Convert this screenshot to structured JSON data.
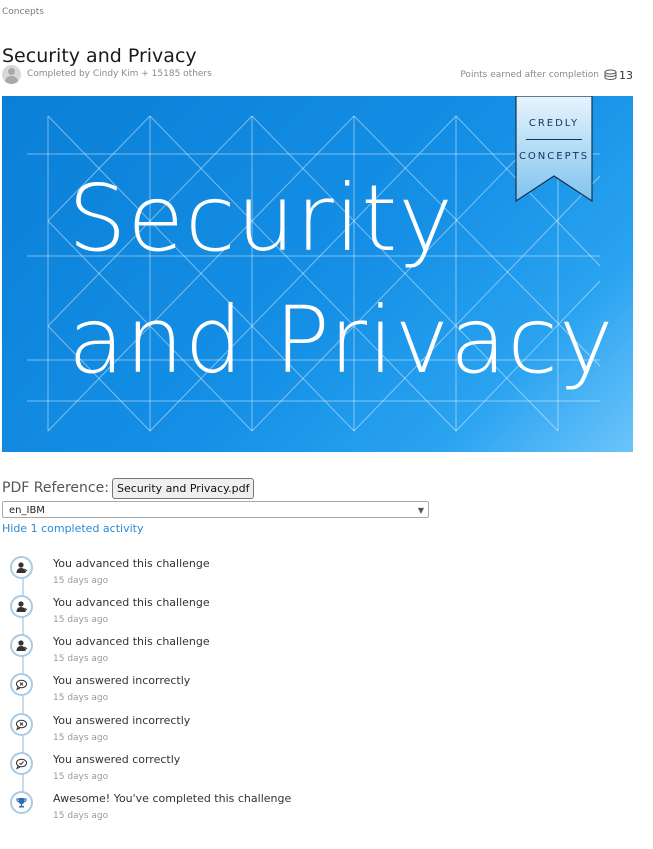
{
  "breadcrumb": "Concepts",
  "title": "Security and Privacy",
  "meta": {
    "completed_text": "Completed by Cindy Kim + 15185 others",
    "points_label": "Points earned after completion",
    "points_value": "13"
  },
  "banner": {
    "title_line1": "Security",
    "title_line2": "and Privacy",
    "ribbon_line1": "CREDLY",
    "ribbon_line2": "CONCEPTS",
    "gradient": [
      "#0a7fd6",
      "#6cc4fa"
    ]
  },
  "pdf": {
    "label": "PDF Reference:",
    "button_label": "Security and Privacy.pdf"
  },
  "language_select": {
    "selected": "en_IBM"
  },
  "hide_link": "Hide 1 completed activity",
  "activities": [
    {
      "icon": "user-advance-icon",
      "title": "You advanced this challenge",
      "time": "15 days ago"
    },
    {
      "icon": "user-advance-icon",
      "title": "You advanced this challenge",
      "time": "15 days ago"
    },
    {
      "icon": "user-advance-icon",
      "title": "You advanced this challenge",
      "time": "15 days ago"
    },
    {
      "icon": "speech-bubble-x-icon",
      "title": "You answered incorrectly",
      "time": "15 days ago"
    },
    {
      "icon": "speech-bubble-x-icon",
      "title": "You answered incorrectly",
      "time": "15 days ago"
    },
    {
      "icon": "speech-bubble-check-icon",
      "title": "You answered correctly",
      "time": "15 days ago"
    },
    {
      "icon": "trophy-icon",
      "title": "Awesome! You've completed this challenge",
      "time": "15 days ago"
    }
  ],
  "colors": {
    "link": "#2b8ad6",
    "timeline_node": "#a9cbe3"
  }
}
